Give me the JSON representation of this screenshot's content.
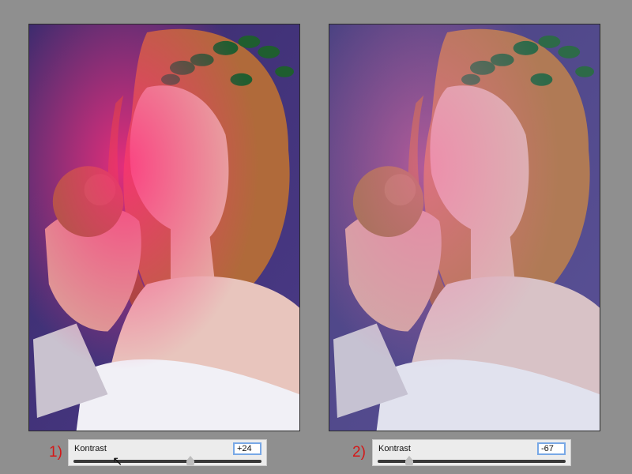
{
  "images": [
    {
      "id": "before-after-1",
      "variant": "high-contrast"
    },
    {
      "id": "before-after-2",
      "variant": "low-contrast"
    }
  ],
  "steps": [
    {
      "marker": "1)",
      "control_label": "Kontrast",
      "value": "+24",
      "slider_fraction": 0.62
    },
    {
      "marker": "2)",
      "control_label": "Kontrast",
      "value": "-67",
      "slider_fraction": 0.17
    }
  ],
  "colors": {
    "background": "#8f8f8f",
    "marker": "#d41818",
    "focus_ring": "#78a8e6"
  },
  "icons": [
    "cursor-arrow-icon"
  ]
}
